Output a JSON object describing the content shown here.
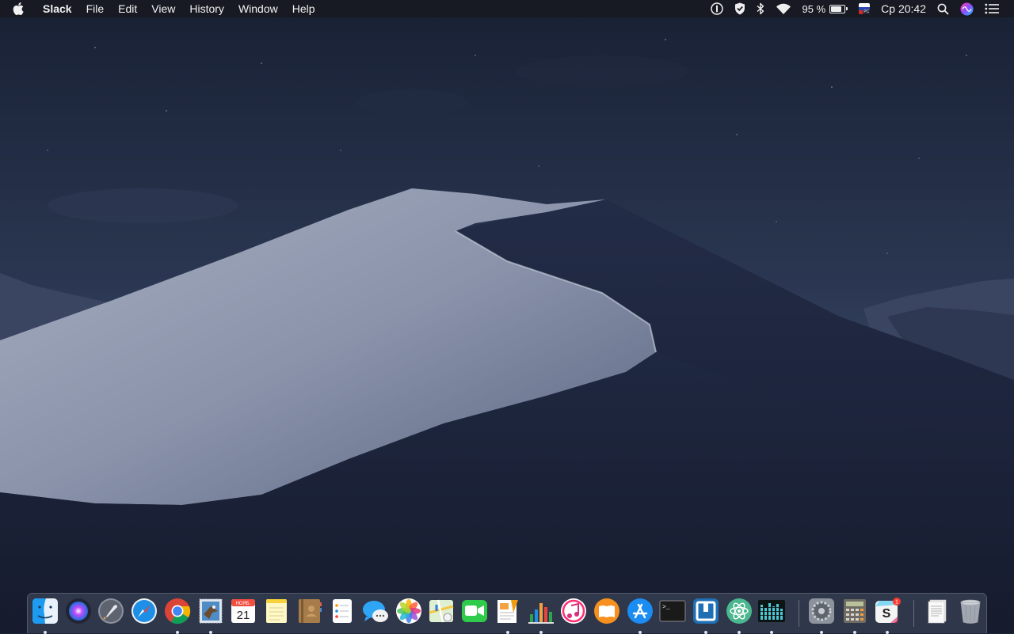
{
  "menubar": {
    "app_name": "Slack",
    "menus": [
      "File",
      "Edit",
      "View",
      "History",
      "Window",
      "Help"
    ],
    "status": {
      "battery_percent": "95 %",
      "battery_level": 0.95,
      "input_source_tag": "PC",
      "clock": "Ср 20:42"
    },
    "icons": [
      "apple-icon",
      "password-manager-icon",
      "vpn-shield-icon",
      "bluetooth-icon",
      "wifi-icon",
      "battery-icon",
      "input-source-flag-icon",
      "spotlight-search-icon",
      "siri-icon",
      "notification-center-icon"
    ]
  },
  "dock": {
    "apps": [
      {
        "id": "finder",
        "running": true
      },
      {
        "id": "siri",
        "running": false
      },
      {
        "id": "launchpad",
        "running": false
      },
      {
        "id": "safari",
        "running": false
      },
      {
        "id": "chrome",
        "running": true
      },
      {
        "id": "mail-eagle",
        "running": true
      },
      {
        "id": "calendar",
        "running": false,
        "month": "НОЯБ.",
        "day": "21"
      },
      {
        "id": "notes",
        "running": false
      },
      {
        "id": "contacts",
        "running": false
      },
      {
        "id": "reminders",
        "running": false
      },
      {
        "id": "messages",
        "running": false
      },
      {
        "id": "photos",
        "running": false
      },
      {
        "id": "maps",
        "running": false
      },
      {
        "id": "facetime",
        "running": false
      },
      {
        "id": "pages",
        "running": true
      },
      {
        "id": "numbers",
        "running": true
      },
      {
        "id": "itunes",
        "running": false
      },
      {
        "id": "books",
        "running": false
      },
      {
        "id": "app-store",
        "running": true
      },
      {
        "id": "terminal",
        "running": false,
        "prompt": ">_"
      },
      {
        "id": "sourcetree",
        "running": true
      },
      {
        "id": "atom",
        "running": true
      },
      {
        "id": "activity-monitor",
        "running": true
      },
      {
        "id": "system-preferences",
        "running": true
      },
      {
        "id": "calculator",
        "running": true
      },
      {
        "id": "slack",
        "running": true,
        "badge": "1"
      },
      {
        "id": "documents-stack",
        "running": false
      },
      {
        "id": "trash",
        "running": false
      }
    ]
  },
  "colors": {
    "menubar_bg": "#181a22",
    "sky_top": "#1b2437",
    "sky_bottom": "#3c4a66",
    "dune_light": "#9aa3b8",
    "dune_dark": "#1c2440"
  }
}
